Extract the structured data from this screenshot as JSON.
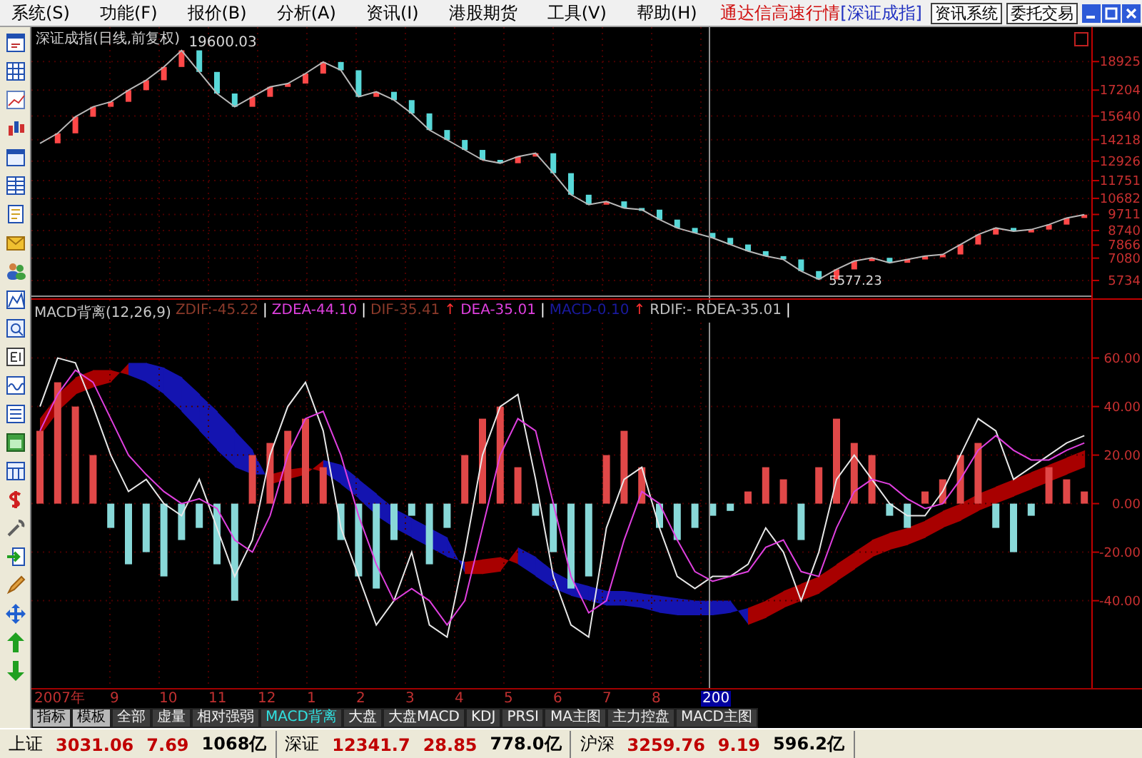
{
  "menu_bar": {
    "items": [
      "系统(S)",
      "功能(F)",
      "报价(B)",
      "分析(A)",
      "资讯(I)",
      "港股期货",
      "工具(V)",
      "帮助(H)"
    ],
    "app_title": "通达信高速行情",
    "market": "[深证成指]",
    "buttons": [
      "资讯系统",
      "委托交易"
    ]
  },
  "price_panel": {
    "title": "深证成指(日线,前复权)",
    "max_label": "19600.03",
    "min_label": "5577.23",
    "chart_data": {
      "type": "line",
      "grid": true,
      "ylim": [
        5000,
        21000
      ],
      "yticks": [
        18925,
        17204,
        15640,
        14218,
        12926,
        11751,
        10682,
        9711,
        8740,
        7866,
        7080,
        5734
      ],
      "series": [
        {
          "color": "#b8b8b8",
          "values": [
            14000,
            14600,
            15600,
            16200,
            16500,
            17200,
            17800,
            18600,
            19600,
            18300,
            17000,
            16200,
            16800,
            17400,
            17600,
            18200,
            18900,
            18400,
            16800,
            17100,
            16600,
            15800,
            14800,
            14200,
            13600,
            13000,
            12800,
            13200,
            13400,
            12200,
            10900,
            10300,
            10500,
            10100,
            10000,
            9400,
            8900,
            8600,
            8300,
            7900,
            7500,
            7200,
            7000,
            6300,
            5800,
            6400,
            6900,
            7100,
            6800,
            7000,
            7200,
            7300,
            7900,
            8500,
            8900,
            8700,
            8800,
            9100,
            9500,
            9700
          ]
        }
      ]
    }
  },
  "indicator_panel": {
    "legend": [
      {
        "text": "MACD背离(12,26,9)",
        "color": "#c8c8c8"
      },
      {
        "text": "ZDIF:-45.22",
        "color": "#8b3a2a"
      },
      {
        "text": "|",
        "color": "#ffffff"
      },
      {
        "text": "ZDEA-44.10",
        "color": "#e040e0"
      },
      {
        "text": "|",
        "color": "#ffffff"
      },
      {
        "text": "DIF-35.41",
        "color": "#8b3a2a"
      },
      {
        "text": "↑",
        "color": "#ff3030"
      },
      {
        "text": "DEA-35.01",
        "color": "#e040e0"
      },
      {
        "text": "|",
        "color": "#ffffff"
      },
      {
        "text": "MACD-0.10",
        "color": "#1a1aa0"
      },
      {
        "text": "↑",
        "color": "#ff3030"
      },
      {
        "text": "RDIF:-",
        "color": "#c0c0c0"
      },
      {
        "text": "RDEA-35.01",
        "color": "#c0c0c0"
      },
      {
        "text": "|",
        "color": "#ffffff"
      }
    ],
    "chart_data": {
      "type": "bar",
      "grid": true,
      "ylim": [
        -76,
        84
      ],
      "yticks": [
        {
          "value": 60,
          "label": "60.00"
        },
        {
          "value": 40,
          "label": "40.00"
        },
        {
          "value": 20,
          "label": "20.00"
        },
        {
          "value": 0,
          "label": "0.00"
        },
        {
          "value": -20,
          "label": "-20.00"
        },
        {
          "value": -40,
          "label": "-40.00"
        }
      ],
      "series": [
        {
          "type": "bar",
          "color": "#e04848",
          "values": [
            30,
            50,
            40,
            20,
            null,
            null,
            null,
            null,
            null,
            null,
            null,
            null,
            20,
            25,
            30,
            35,
            15,
            null,
            null,
            null,
            null,
            null,
            null,
            null,
            20,
            35,
            40,
            15,
            null,
            null,
            null,
            null,
            20,
            30,
            15,
            null,
            null,
            null,
            null,
            null,
            5,
            15,
            10,
            null,
            15,
            35,
            25,
            20,
            null,
            null,
            5,
            10,
            20,
            25,
            null,
            null,
            null,
            15,
            10,
            5
          ]
        },
        {
          "type": "bar",
          "color": "#88d8d8",
          "values": [
            null,
            null,
            null,
            null,
            -10,
            -25,
            -20,
            -30,
            -15,
            -10,
            -25,
            -40,
            null,
            null,
            null,
            null,
            null,
            -15,
            -30,
            -35,
            -15,
            -5,
            -25,
            -10,
            null,
            null,
            null,
            null,
            -5,
            -20,
            -35,
            -30,
            null,
            null,
            null,
            -10,
            -15,
            -10,
            -5,
            -3,
            null,
            null,
            null,
            -15,
            null,
            null,
            null,
            null,
            -5,
            -10,
            null,
            null,
            null,
            null,
            -10,
            -20,
            -5,
            null,
            null,
            null
          ]
        },
        {
          "type": "line",
          "color": "#e8e8e8",
          "values": [
            40,
            60,
            58,
            40,
            20,
            5,
            10,
            0,
            -5,
            10,
            -10,
            -30,
            -15,
            20,
            40,
            50,
            30,
            -10,
            -30,
            -50,
            -40,
            -20,
            -50,
            -55,
            -20,
            20,
            40,
            45,
            10,
            -30,
            -50,
            -55,
            -10,
            10,
            15,
            -10,
            -30,
            -35,
            -30,
            -30,
            -25,
            -10,
            -20,
            -40,
            -20,
            10,
            20,
            10,
            0,
            -5,
            -5,
            5,
            20,
            35,
            30,
            10,
            15,
            20,
            25,
            28
          ]
        },
        {
          "type": "line",
          "color": "#e040e0",
          "values": [
            30,
            45,
            55,
            50,
            35,
            20,
            12,
            5,
            0,
            2,
            -2,
            -15,
            -20,
            -5,
            20,
            35,
            38,
            20,
            -5,
            -25,
            -40,
            -35,
            -40,
            -50,
            -40,
            -10,
            20,
            35,
            30,
            0,
            -30,
            -45,
            -40,
            -15,
            5,
            0,
            -15,
            -28,
            -32,
            -30,
            -28,
            -18,
            -15,
            -28,
            -30,
            -10,
            5,
            10,
            8,
            2,
            -2,
            0,
            10,
            22,
            28,
            22,
            18,
            18,
            22,
            25
          ]
        }
      ]
    }
  },
  "date_axis": [
    {
      "label": "2007年",
      "kind": "tick"
    },
    {
      "label": "9",
      "kind": "tick"
    },
    {
      "label": "10",
      "kind": "tick"
    },
    {
      "label": "11",
      "kind": "tick"
    },
    {
      "label": "12",
      "kind": "tick"
    },
    {
      "label": "1",
      "kind": "tick"
    },
    {
      "label": "2",
      "kind": "tick"
    },
    {
      "label": "3",
      "kind": "tick"
    },
    {
      "label": "4",
      "kind": "tick"
    },
    {
      "label": "5",
      "kind": "tick"
    },
    {
      "label": "6",
      "kind": "tick"
    },
    {
      "label": "7",
      "kind": "tick"
    },
    {
      "label": "8",
      "kind": "tick"
    },
    {
      "label": "200",
      "kind": "cursor"
    }
  ],
  "tab_bar": {
    "tabs": [
      {
        "label": "指标",
        "kind": "button",
        "selected": false
      },
      {
        "label": "模板",
        "kind": "button",
        "selected": false
      },
      {
        "label": "全部",
        "kind": "tab",
        "selected": false
      },
      {
        "label": "虚量",
        "kind": "tab",
        "selected": false
      },
      {
        "label": "相对强弱",
        "kind": "tab",
        "selected": false
      },
      {
        "label": "MACD背离",
        "kind": "tab",
        "selected": true
      },
      {
        "label": "大盘",
        "kind": "tab",
        "selected": false
      },
      {
        "label": "大盘MACD",
        "kind": "tab",
        "selected": false
      },
      {
        "label": "KDJ",
        "kind": "tab",
        "selected": false
      },
      {
        "label": "PRSI",
        "kind": "tab",
        "selected": false
      },
      {
        "label": "MA主图",
        "kind": "tab",
        "selected": false
      },
      {
        "label": "主力控盘",
        "kind": "tab",
        "selected": false
      },
      {
        "label": "MACD主图",
        "kind": "tab",
        "selected": false
      }
    ]
  },
  "status_bar": [
    {
      "market": "上证",
      "index": "3031.06",
      "change": "7.69",
      "turnover": "1068亿"
    },
    {
      "market": "深证",
      "index": "12341.7",
      "change": "28.85",
      "turnover": "778.0亿"
    },
    {
      "market": "沪深",
      "index": "3259.76",
      "change": "9.19",
      "turnover": "596.2亿"
    }
  ]
}
